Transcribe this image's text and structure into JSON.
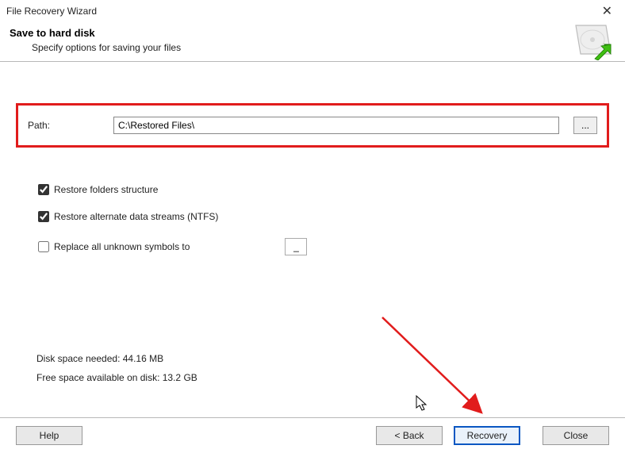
{
  "window": {
    "title": "File Recovery Wizard"
  },
  "header": {
    "title": "Save to hard disk",
    "subtitle": "Specify options for saving your files"
  },
  "path": {
    "label": "Path:",
    "value": "C:\\Restored Files\\",
    "browse_label": "..."
  },
  "options": {
    "restore_folders": {
      "label": "Restore folders structure",
      "checked": true
    },
    "restore_ads": {
      "label": "Restore alternate data streams (NTFS)",
      "checked": true
    },
    "replace_symbols": {
      "label": "Replace all unknown symbols to",
      "checked": false,
      "value": "_"
    }
  },
  "disk": {
    "needed": "Disk space needed: 44.16 MB",
    "free": "Free space available on disk: 13.2 GB"
  },
  "buttons": {
    "help": "Help",
    "back": "< Back",
    "recovery": "Recovery",
    "close": "Close"
  }
}
